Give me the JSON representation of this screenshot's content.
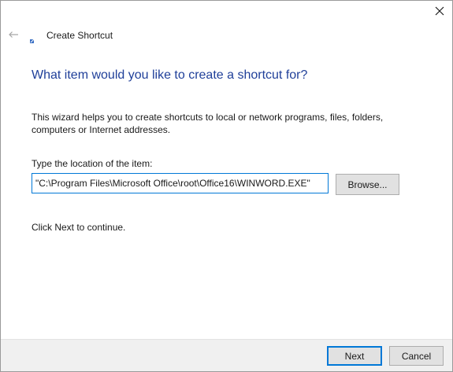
{
  "window": {
    "title": "Create Shortcut"
  },
  "icons": {
    "close": "close-icon",
    "back": "back-arrow-icon",
    "app": "shortcut-app-icon"
  },
  "content": {
    "heading": "What item would you like to create a shortcut for?",
    "description": "This wizard helps you to create shortcuts to local or network programs, files, folders, computers or Internet addresses.",
    "location_label": "Type the location of the item:",
    "location_value": "\"C:\\Program Files\\Microsoft Office\\root\\Office16\\WINWORD.EXE\"",
    "browse_label": "Browse...",
    "continue_text": "Click Next to continue."
  },
  "footer": {
    "next_label": "Next",
    "cancel_label": "Cancel"
  },
  "colors": {
    "heading": "#1f3f99",
    "accent": "#0078d7",
    "button_bg": "#e1e1e1",
    "footer_bg": "#f0f0f0"
  }
}
